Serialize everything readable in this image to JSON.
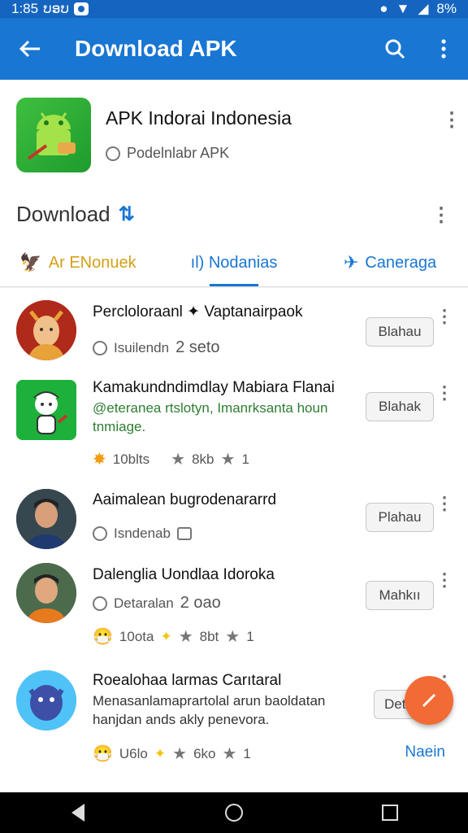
{
  "status": {
    "time": "1:85",
    "left_text": "ບອບ",
    "battery": "8%"
  },
  "appbar": {
    "title": "Download APK"
  },
  "header": {
    "app_name": "APK Indorai Indonesia",
    "app_sub": "Podelnlabr APK",
    "section_title": "Download",
    "tabs": [
      {
        "label": "Ar ENonuek"
      },
      {
        "label": "ıl) Nodanias"
      },
      {
        "label": "Caneraga"
      }
    ]
  },
  "items": [
    {
      "title": "Percloloraanl ✦ Vaptanairpaok",
      "meta": "Isuilendn",
      "meta2": "2 seto",
      "action": "Blahau"
    },
    {
      "title": "Kamakundndimdlay Mabiara Flanai",
      "desc": "@eteranea rtslotyn, Imanrksanta houn tnmiage.",
      "action": "Blahak",
      "stat1": "10blts",
      "stat2": "8kb",
      "stat3": "1"
    },
    {
      "title": "Aaimalean bugrodenararrd",
      "meta": "Isndenab",
      "action": "Plahau"
    },
    {
      "title": "Dalenglia Uondlaa Idoroka",
      "meta": "Detaralan",
      "meta2": "2 oao",
      "action": "Mahkıı",
      "stat1": "10ota",
      "stat2": "8bt",
      "stat3": "1"
    },
    {
      "title": "Roealohaa larmas Carıtaral",
      "desc": "Menasanlamaprartolal arun baoldatan hanjdan ands akly penevora.",
      "action": "Det",
      "stat1": "U6lo",
      "stat2": "6ko",
      "stat3": "1",
      "link": "Naein"
    }
  ],
  "icons": {
    "back": "arrow-back-icon",
    "search": "search-icon",
    "more": "more-vert-icon",
    "fab": "edit-icon"
  },
  "colors": {
    "primary": "#1976d2",
    "accent": "#f26b34",
    "tab_gold": "#d4a017"
  }
}
